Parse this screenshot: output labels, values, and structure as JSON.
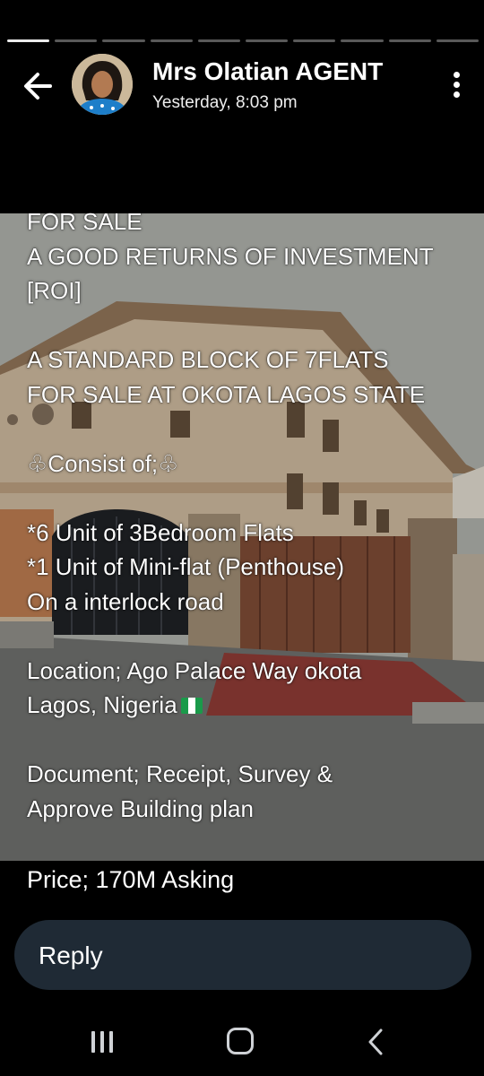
{
  "story": {
    "segments_total": 10,
    "segments_done": 1
  },
  "header": {
    "name": "Mrs Olatian AGENT",
    "timestamp": "Yesterday, 8:03 pm",
    "back_icon": "arrow-left-icon",
    "menu_icon": "more-vertical-icon"
  },
  "post": {
    "caption_lines": [
      "FOR SALE",
      "A GOOD RETURNS OF INVESTMENT",
      "[ROI]",
      "",
      "A STANDARD BLOCK OF 7FLATS",
      "FOR SALE AT OKOTA LAGOS STATE",
      "",
      "♧Consist of;♧",
      "",
      "*6 Unit of 3Bedroom Flats",
      "*1 Unit of Mini-flat (Penthouse)",
      "On a interlock road",
      "",
      "Location; Ago Palace Way okota",
      "Lagos, Nigeria",
      "",
      "Document; Receipt, Survey &",
      "Approve Building plan"
    ],
    "price": "Price; 170M Asking"
  },
  "reply": {
    "label": "Reply"
  },
  "nav": {
    "recent_icon": "recent-apps-icon",
    "home_icon": "home-icon",
    "back_icon": "nav-back-icon"
  }
}
